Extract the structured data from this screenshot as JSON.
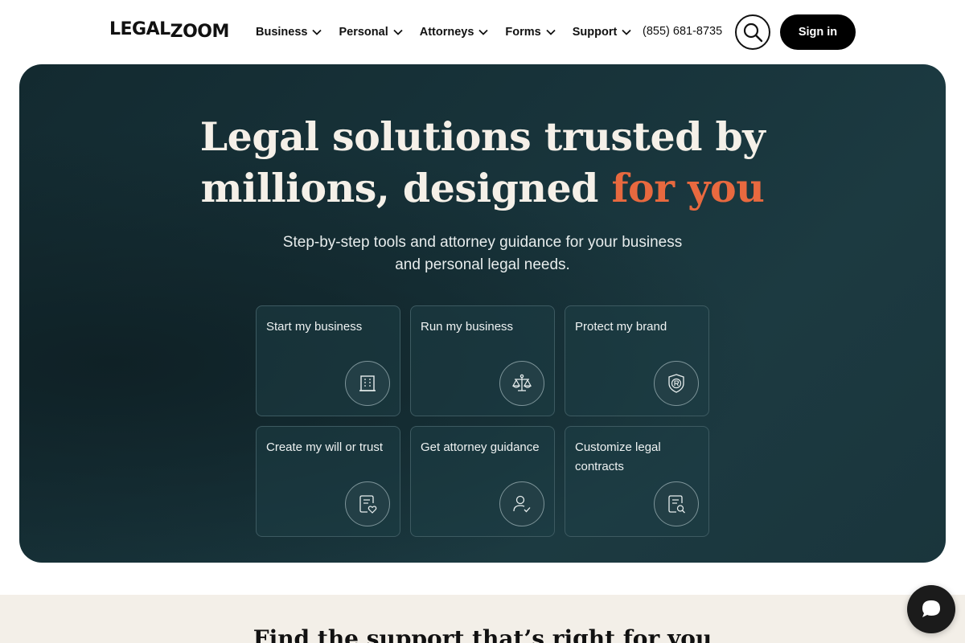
{
  "header": {
    "logo_legal": "LEGAL",
    "logo_zoom": "ZOOM",
    "nav": [
      {
        "label": "Business"
      },
      {
        "label": "Personal"
      },
      {
        "label": "Attorneys"
      },
      {
        "label": "Forms"
      },
      {
        "label": "Support"
      }
    ],
    "phone": "(855) 681-8735",
    "signin_label": "Sign in"
  },
  "hero": {
    "title_line1": "Legal solutions trusted by",
    "title_line2_main": "millions, designed ",
    "title_line2_accent": "for you",
    "subtitle": "Step-by-step tools and attorney guidance for your business and personal legal needs.",
    "accent_color": "#e8693f",
    "cards": [
      {
        "label": "Start my business",
        "icon": "building-icon"
      },
      {
        "label": "Run my business",
        "icon": "scales-icon"
      },
      {
        "label": "Protect my brand",
        "icon": "registered-shield-icon"
      },
      {
        "label": "Create my will or trust",
        "icon": "document-heart-icon"
      },
      {
        "label": "Get attorney guidance",
        "icon": "person-check-icon"
      },
      {
        "label": "Customize legal contracts",
        "icon": "document-search-icon"
      }
    ]
  },
  "lower": {
    "title": "Find the support that’s right for you"
  }
}
